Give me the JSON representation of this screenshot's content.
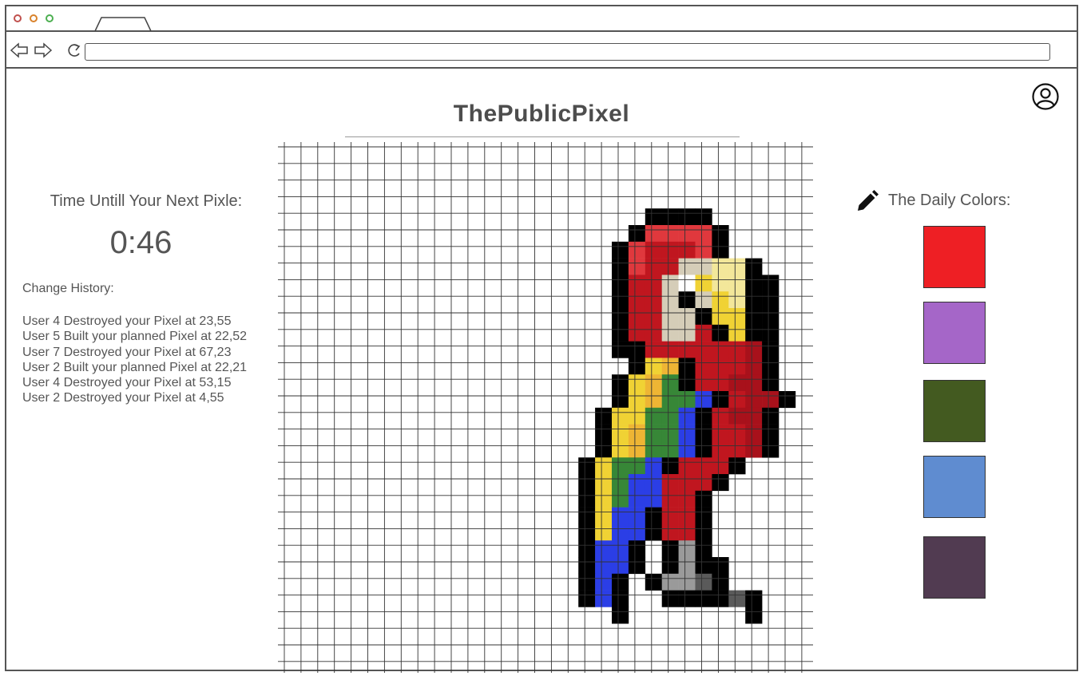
{
  "app": {
    "title": "ThePublicPixel"
  },
  "icons": {
    "profile": "user-circle-icon",
    "pencil": "pencil-icon",
    "back": "back-arrow-icon",
    "forward": "forward-arrow-icon",
    "reload": "reload-icon"
  },
  "timer": {
    "label": "Time Untill Your Next Pixle:",
    "value": "0:46"
  },
  "history": {
    "label": "Change History:",
    "items": [
      "User 4 Destroyed your Pixel at 23,55",
      "User 5 Built your planned Pixel at 22,52",
      "User 7 Destroyed your Pixel at 67,23",
      "User 2 Built your planned Pixel at 22,21",
      "User 4 Destroyed your Pixel at 53,15",
      "User 2 Destroyed your Pixel at 4,55"
    ]
  },
  "daily_colors": {
    "label": "The Daily Colors:",
    "swatches": [
      "#ee1f24",
      "#a566c8",
      "#435a20",
      "#5f8cd0",
      "#513b51"
    ]
  },
  "canvas": {
    "columns": 32,
    "rows": 32,
    "palette": {
      "K": "#000000",
      "R": "#c0161f",
      "r": "#e0383d",
      "D": "#a8111b",
      "C": "#d5cdb8",
      "W": "#ffffff",
      "Y": "#f0d234",
      "y": "#f3e79a",
      "o": "#eeb534",
      "G": "#378737",
      "B": "#2b3ee6",
      "g": "#9a9a9a",
      "d": "#5a5a5a"
    },
    "pixels": [
      "",
      "",
      "",
      "",
      "..........................KKKK",
      ".........................KrrrrK",
      "........................KrRRRrK",
      "........................KrRRCCyyK",
      "........................KRRCWYyyKK",
      "........................KRRCKCYyKK",
      "........................KRRCCKYYKK",
      "........................KRRCCRKYKK",
      "........................KKRRRRRRDK",
      ".........................KYoKRRRDK",
      "........................KYoGKRRDDK",
      "........................KYoGGBKRDDK",
      ".......................KYYGGBKRDDK",
      ".......................KYoGGBKRRDK",
      ".......................KYoGGBKRRDK",
      "......................KYGGBKRRRK",
      "......................KYGBBRRRK",
      "......................KYGBBRRK",
      "......................KYBBKRRK",
      "......................KYBBKRRK",
      "......................KBBK.KgK",
      "......................KBBK.KgKK",
      "......................KBK.KggdK",
      "......................KBK..KKKKdK",
      "........................K.......K"
    ]
  }
}
